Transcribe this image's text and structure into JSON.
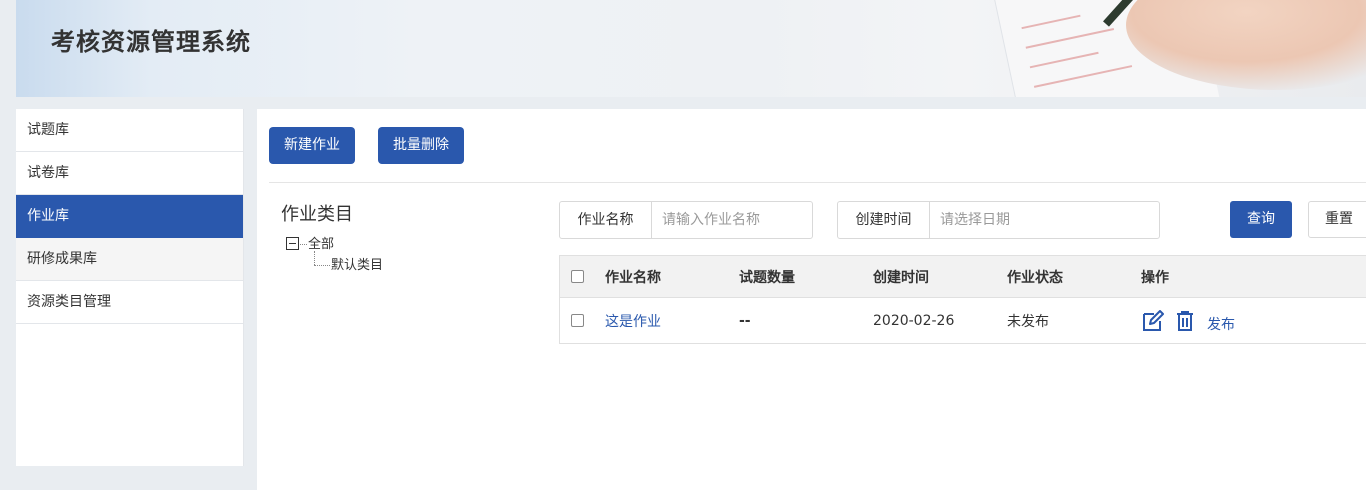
{
  "header": {
    "title": "考核资源管理系统"
  },
  "sidebar": {
    "items": [
      {
        "label": "试题库"
      },
      {
        "label": "试卷库"
      },
      {
        "label": "作业库"
      },
      {
        "label": "研修成果库"
      },
      {
        "label": "资源类目管理"
      }
    ]
  },
  "toolbar": {
    "new_label": "新建作业",
    "batch_delete_label": "批量删除"
  },
  "category": {
    "title": "作业类目",
    "tree": {
      "root": "全部",
      "child": "默认类目"
    }
  },
  "filters": {
    "name_label": "作业名称",
    "name_placeholder": "请输入作业名称",
    "date_label": "创建时间",
    "date_placeholder": "请选择日期",
    "query_label": "查询",
    "reset_label": "重置"
  },
  "table": {
    "headers": [
      "作业名称",
      "试题数量",
      "创建时间",
      "作业状态",
      "操作"
    ],
    "rows": [
      {
        "name": "这是作业",
        "count": "--",
        "created": "2020-02-26",
        "status": "未发布",
        "publish": "发布"
      }
    ]
  },
  "colors": {
    "accent": "#2a58ad",
    "background": "#e9edf1"
  },
  "icons": [
    "minus-square-icon",
    "edit-icon",
    "trash-icon"
  ]
}
